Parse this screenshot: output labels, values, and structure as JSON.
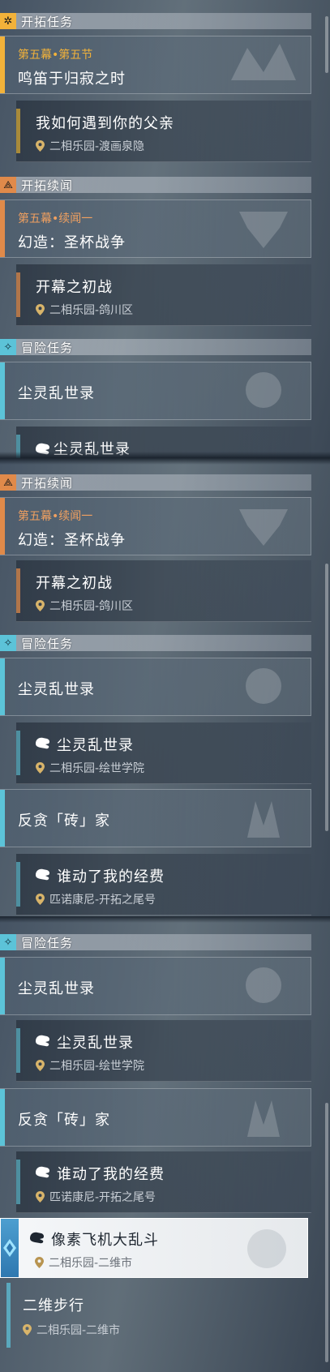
{
  "colors": {
    "trailblaze_accent": "#f2b23a",
    "companion_accent": "#e08a4a",
    "adventure_accent": "#5cc3d8",
    "trailblaze_sub": "#a88a3a",
    "companion_sub": "#b0754a",
    "adventure_sub": "#4e8fa0"
  },
  "sections": {
    "trailblaze": {
      "title": "开拓任务",
      "icon": "trailblaze-icon"
    },
    "companion": {
      "title": "开拓续闻",
      "icon": "companion-icon"
    },
    "adventure": {
      "title": "冒险任务",
      "icon": "adventure-icon"
    }
  },
  "quests": {
    "trailblaze_main": {
      "chapter": "第五幕•第五节",
      "title": "鸣笛于归寂之时"
    },
    "trailblaze_step": {
      "title": "我如何遇到你的父亲",
      "location": "二相乐园-渡画泉隐"
    },
    "companion_main": {
      "chapter": "第五幕•续闻一",
      "title": "幻造：圣杯战争"
    },
    "companion_step": {
      "title": "开幕之初战",
      "location": "二相乐园-鸽川区"
    },
    "dust_main": {
      "title": "尘灵乱世录"
    },
    "dust_step": {
      "title": "尘灵乱世录",
      "location": "二相乐园-绘世学院"
    },
    "brick_main": {
      "title": "反贪「砖」家"
    },
    "brick_step": {
      "title": "谁动了我的经费",
      "location": "匹诺康尼-开拓之尾号"
    },
    "pixel_step": {
      "title": "像素飞机大乱斗",
      "location": "二相乐园-二维市"
    },
    "twod_main": {
      "title": "二维步行",
      "location": "二相乐园-二维市"
    }
  }
}
